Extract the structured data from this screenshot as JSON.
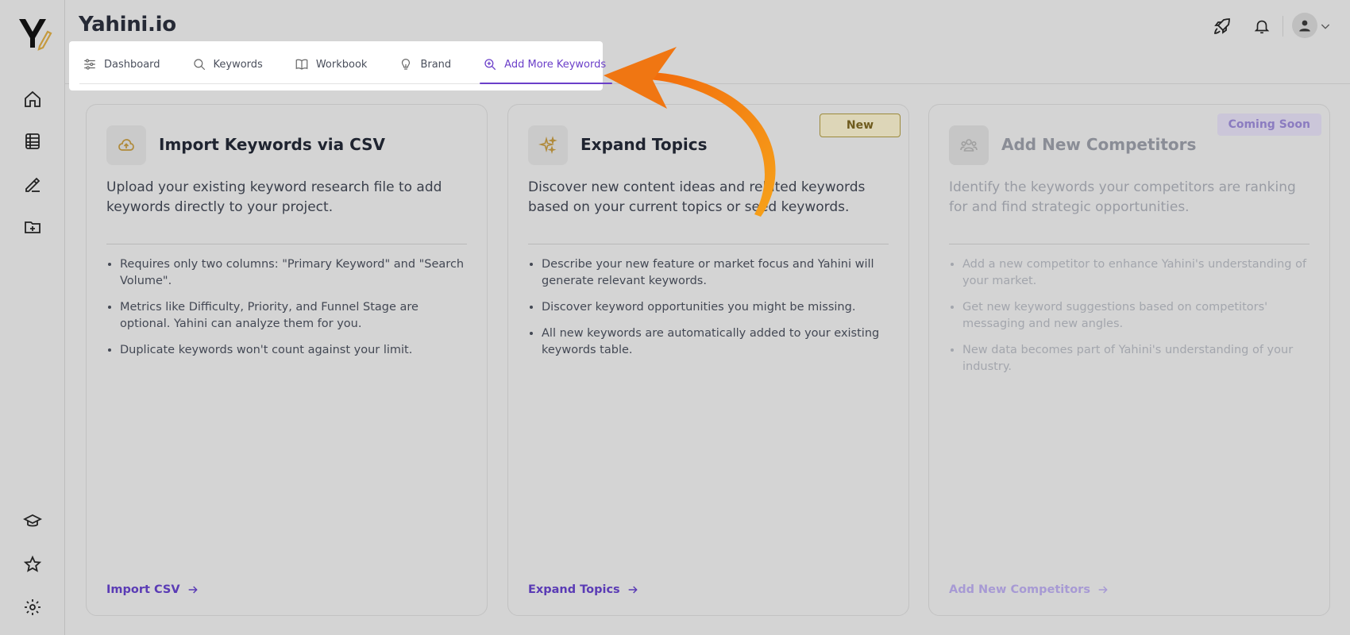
{
  "app": {
    "title": "Yahini.io"
  },
  "tabs": [
    {
      "label": "Dashboard",
      "icon": "sliders-icon"
    },
    {
      "label": "Keywords",
      "icon": "search-icon"
    },
    {
      "label": "Workbook",
      "icon": "book-icon"
    },
    {
      "label": "Brand",
      "icon": "lightbulb-icon"
    },
    {
      "label": "Add More Keywords",
      "icon": "zoom-plus-icon",
      "active": true
    }
  ],
  "cards": [
    {
      "title": "Import Keywords via CSV",
      "description": "Upload your existing keyword research file to add keywords directly to your project.",
      "bullets": [
        "Requires only two columns: \"Primary Keyword\" and \"Search Volume\".",
        "Metrics like Difficulty, Priority, and Funnel Stage are optional. Yahini can analyze them for you.",
        "Duplicate keywords won't count against your limit."
      ],
      "link": "Import CSV"
    },
    {
      "title": "Expand Topics",
      "badge": "New",
      "description": "Discover new content ideas and related keywords based on your current topics or seed keywords.",
      "bullets": [
        "Describe your new feature or market focus and Yahini will generate relevant keywords.",
        "Discover keyword opportunities you might be missing.",
        "All new keywords are automatically added to your existing keywords table."
      ],
      "link": "Expand Topics"
    },
    {
      "title": "Add New Competitors",
      "badge": "Coming Soon",
      "description": "Identify the keywords your competitors are ranking for and find strategic opportunities.",
      "bullets": [
        "Add a new competitor to enhance Yahini's understanding of your market.",
        "Get new keyword suggestions based on competitors' messaging and new angles.",
        "New data becomes part of Yahini's understanding of your industry."
      ],
      "link": "Add New Competitors"
    }
  ],
  "colors": {
    "accent": "#6b3fc9",
    "background": "#d4d4d4",
    "arrow": "#f2820f",
    "new_badge": "#ddd6b8"
  }
}
